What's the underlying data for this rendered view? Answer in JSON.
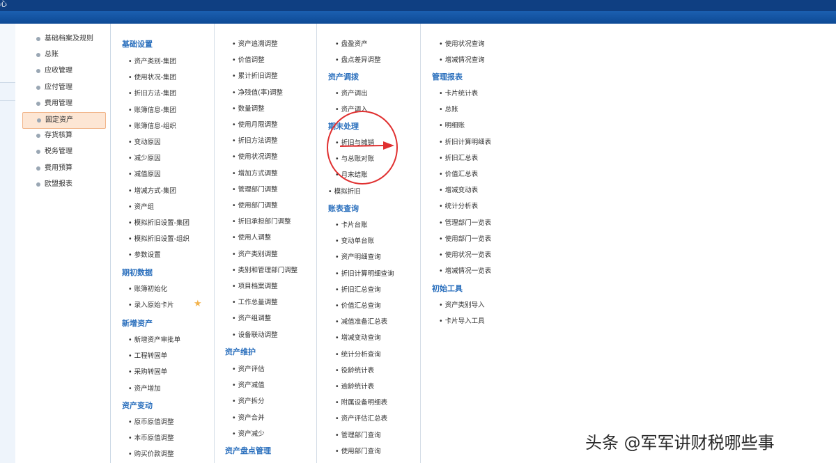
{
  "window": {
    "title_fragment": "心"
  },
  "sidebar": {
    "items": [
      {
        "label": "基础档案及规则"
      },
      {
        "label": "总账"
      },
      {
        "label": "应收管理"
      },
      {
        "label": "应付管理"
      },
      {
        "label": "费用管理"
      },
      {
        "label": "固定资产",
        "active": true
      },
      {
        "label": "存货核算"
      },
      {
        "label": "税务管理"
      },
      {
        "label": "费用预算"
      },
      {
        "label": "欧盟报表"
      }
    ]
  },
  "col1": {
    "base": {
      "title": "基础设置",
      "items": [
        "资产类别-集团",
        "使用状况-集团",
        "折旧方法-集团",
        "账簿信息-集团",
        "账簿信息-组织",
        "变动原因",
        "减少原因",
        "减值原因",
        "增减方式-集团",
        "资产组",
        "模拟折旧设置-集团",
        "模拟折旧设置-组织",
        "参数设置"
      ]
    },
    "init": {
      "title": "期初数据",
      "items": [
        "账簿初始化",
        "录入原始卡片"
      ]
    },
    "add": {
      "title": "新增资产",
      "items": [
        "新增资产审批单",
        "工程转固单",
        "采购转固单",
        "资产增加"
      ]
    },
    "change": {
      "title": "资产变动",
      "items": [
        "原币原值调整",
        "本币原值调整",
        "购买价款调整"
      ]
    }
  },
  "col2": {
    "adjust": {
      "items": [
        "资产追溯调整",
        "价值调整",
        "累计折旧调整",
        "净残值(率)调整",
        "数量调整",
        "使用月限调整",
        "折旧方法调整",
        "使用状况调整",
        "增加方式调整",
        "管理部门调整",
        "使用部门调整",
        "折旧承担部门调整",
        "使用人调整",
        "资产类别调整",
        "类别和管理部门调整",
        "项目档案调整",
        "工作总量调整",
        "资产组调整",
        "设备联动调整"
      ]
    },
    "maintain": {
      "title": "资产维护",
      "items": [
        "资产评估",
        "资产减值",
        "资产拆分",
        "资产合并",
        "资产减少"
      ]
    },
    "count": {
      "title": "资产盘点管理"
    }
  },
  "col3": {
    "count_items": {
      "items": [
        "盘盈资产",
        "盘点差异调整"
      ]
    },
    "transfer": {
      "title": "资产调拨",
      "items": [
        "资产调出",
        "资产调入"
      ]
    },
    "period": {
      "title": "期末处理",
      "items": [
        "折旧与摊销",
        "与总账对账",
        "月末结账"
      ]
    },
    "sim": {
      "label": "模拟折旧"
    },
    "query": {
      "title": "账表查询",
      "items": [
        "卡片台账",
        "变动单台账",
        "资产明细查询",
        "折旧计算明细查询",
        "折旧汇总查询",
        "价值汇总查询",
        "减值准备汇总表",
        "增减变动查询",
        "统计分析查询",
        "役龄统计表",
        "逾龄统计表",
        "附属设备明细表",
        "资产评估汇总表",
        "管理部门查询",
        "使用部门查询"
      ]
    }
  },
  "col4": {
    "top": {
      "items": [
        "使用状况查询",
        "增减情况查询"
      ]
    },
    "reports": {
      "title": "管理报表",
      "items": [
        "卡片统计表",
        "总账",
        "明细账",
        "折旧计算明细表",
        "折旧汇总表",
        "价值汇总表",
        "增减变动表",
        "统计分析表",
        "管理部门一览表",
        "使用部门一览表",
        "使用状况一览表",
        "增减情况一览表"
      ]
    },
    "tools": {
      "title": "初始工具",
      "items": [
        "资产类别导入",
        "卡片导入工具"
      ]
    }
  },
  "watermark": "头条 @军军讲财税哪些事",
  "colors": {
    "accent": "#2a6fbd",
    "header": "#0f3f82",
    "highlight": "#e03030"
  }
}
